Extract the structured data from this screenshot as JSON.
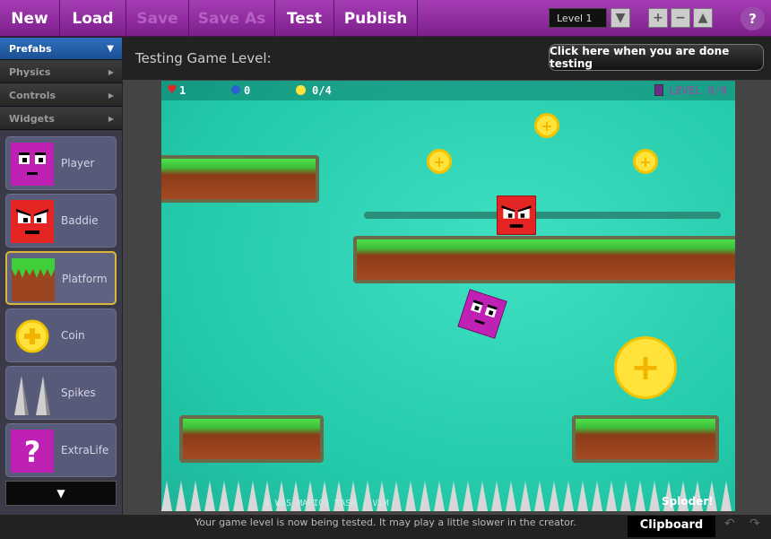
{
  "toolbar": {
    "buttons": [
      {
        "label": "New"
      },
      {
        "label": "Load"
      },
      {
        "label": "Save"
      },
      {
        "label": "Save As"
      },
      {
        "label": "Test"
      },
      {
        "label": "Publish"
      }
    ],
    "level_select": "Level 1",
    "help": "?"
  },
  "sidebar": {
    "categories": [
      {
        "label": "Prefabs"
      },
      {
        "label": "Physics"
      },
      {
        "label": "Controls"
      },
      {
        "label": "Widgets"
      }
    ],
    "prefabs": [
      {
        "label": "Player"
      },
      {
        "label": "Baddie"
      },
      {
        "label": "Platform"
      },
      {
        "label": "Coin"
      },
      {
        "label": "Spikes"
      },
      {
        "label": "ExtraLife"
      }
    ]
  },
  "header": {
    "title": "Testing Game Level:",
    "done_button": "Click here when you are done testing"
  },
  "hud": {
    "lives": "1",
    "keys": "0",
    "coins": "0/4",
    "level": "LEVEL 0/0"
  },
  "game": {
    "music": "I WAS MARIOS TASH - VIM",
    "brand": "Sploder!"
  },
  "footer": {
    "status": "Your game level is now being tested. It may play a little slower in the creator.",
    "clipboard": "Clipboard"
  },
  "colors": {
    "toolbar": "#8e2a9e",
    "accent_blue": "#1b5cad",
    "game_bg": "#2fd3b4",
    "coin": "#ffe23a",
    "baddie": "#e52424",
    "player": "#c021b5"
  }
}
